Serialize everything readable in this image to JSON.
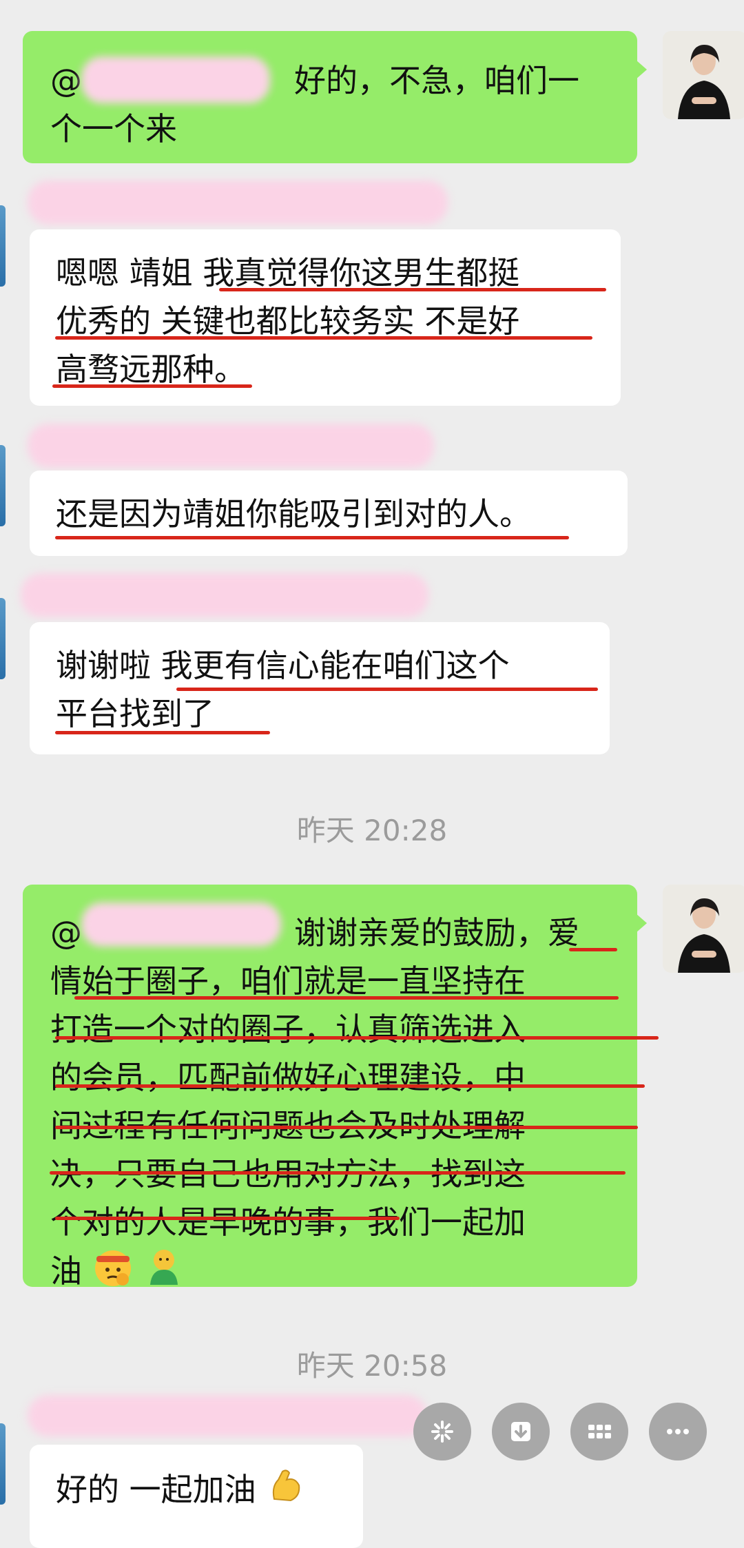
{
  "messages": {
    "m1": {
      "at": "@",
      "line1_rest": "好的，不急，咱们一",
      "line2": "个一个来"
    },
    "m2": {
      "line1": "嗯嗯 靖姐 我真觉得你这男生都挺",
      "line2": "优秀的 关键也都比较务实 不是好",
      "line3": "高骛远那种。"
    },
    "m3": {
      "line1": "还是因为靖姐你能吸引到对的人。"
    },
    "m4": {
      "line1": "谢谢啦 我更有信心能在咱们这个",
      "line2": "平台找到了"
    },
    "m5": {
      "at": "@",
      "line1_rest": "谢谢亲爱的鼓励，爱",
      "line2": "情始于圈子，咱们就是一直坚持在",
      "line3": "打造一个对的圈子，认真筛选进入",
      "line4": "的会员，匹配前做好心理建设，中",
      "line5": "间过程有任何问题也会及时处理解",
      "line6": "决，只要自己也用对方法，找到这",
      "line7": "个对的人是早晚的事，我们一起加",
      "line8": "油"
    },
    "m6": {
      "line1": "好的 一起加油"
    }
  },
  "timestamps": {
    "t1": "昨天 20:28",
    "t2": "昨天 20:58"
  },
  "icons": {
    "emoji_1": "determined-face-headband-emoji",
    "emoji_2": "green-figure-emoji",
    "emoji_3": "flexed-biceps-emoji",
    "action_1": "sparkle-icon",
    "action_2": "download-icon",
    "action_3": "grid-icon",
    "action_4": "more-icon"
  },
  "colors": {
    "own_bubble": "#95ec69",
    "other_bubble": "#ffffff",
    "background": "#ededed",
    "underline": "#d8261a",
    "redaction": "#fbd3e6"
  }
}
